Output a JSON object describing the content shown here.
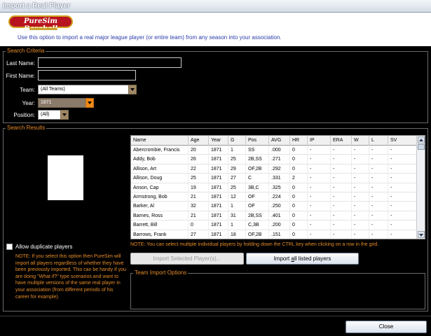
{
  "window": {
    "title": "Import a Real Player"
  },
  "banner": {
    "logo_text": "PureSim Baseball",
    "description": "Use this option to import a real major league player (or entire team) from any season into your association."
  },
  "search_criteria": {
    "label": "Search Criteria",
    "last_name_label": "Last Name:",
    "last_name_value": "",
    "first_name_label": "First Name:",
    "first_name_value": "",
    "team_label": "Team:",
    "team_value": "(All Teams)",
    "year_label": "Year:",
    "year_value": "1871",
    "position_label": "Position:",
    "position_value": "(All)"
  },
  "search_results": {
    "label": "Search Results",
    "allow_duplicates_label": "Allow duplicate players",
    "allow_duplicates_checked": false,
    "note": "NOTE: If you select this option then PureSim will import all players regardless of whether they have been previously imported.  This can be handy if you are doing \"What if?\" type scenarios and want to have multiple versions of the same real player in your association (from different periods of his career for example).",
    "grid_note": "NOTE: You can select multiple individual players by holding down the CTRL key when clicking on a row in the grid.",
    "columns": [
      "Name",
      "Age",
      "Year",
      "G",
      "Pos",
      "AVG",
      "HR",
      "IP",
      "ERA",
      "W",
      "L",
      "SV"
    ],
    "rows": [
      [
        "Abercrombie, Francis",
        "20",
        "1871",
        "1",
        "SS",
        ".000",
        "0",
        "-",
        "-",
        "-",
        "-",
        "-"
      ],
      [
        "Addy, Bob",
        "26",
        "1871",
        "25",
        "2B,SS",
        ".271",
        "0",
        "-",
        "-",
        "-",
        "-",
        "-"
      ],
      [
        "Allison, Art",
        "22",
        "1871",
        "29",
        "OF,2B",
        ".292",
        "0",
        "-",
        "-",
        "-",
        "-",
        "-"
      ],
      [
        "Allison, Doug",
        "25",
        "1871",
        "27",
        "C",
        ".331",
        "2",
        "-",
        "-",
        "-",
        "-",
        "-"
      ],
      [
        "Anson, Cap",
        "19",
        "1871",
        "25",
        "3B,C",
        ".325",
        "0",
        "-",
        "-",
        "-",
        "-",
        "-"
      ],
      [
        "Armstrong, Bob",
        "21",
        "1871",
        "12",
        "OF",
        ".224",
        "0",
        "-",
        "-",
        "-",
        "-",
        "-"
      ],
      [
        "Barker, Al",
        "32",
        "1871",
        "1",
        "OF",
        ".250",
        "0",
        "-",
        "-",
        "-",
        "-",
        "-"
      ],
      [
        "Barnes, Ross",
        "21",
        "1871",
        "31",
        "2B,SS",
        ".401",
        "0",
        "-",
        "-",
        "-",
        "-",
        "-"
      ],
      [
        "Barrett, Bill",
        "0",
        "1871",
        "1",
        "C,3B",
        ".200",
        "0",
        "-",
        "-",
        "-",
        "-",
        "-"
      ],
      [
        "Barrows, Frank",
        "27",
        "1871",
        "18",
        "OF,2B",
        ".151",
        "0",
        "-",
        "-",
        "-",
        "-",
        "-"
      ]
    ]
  },
  "buttons": {
    "import_selected": "Import Selected Player(s)...",
    "import_all_pre": "Import ",
    "import_all_u": "a",
    "import_all_post": "ll listed players",
    "close": "Close"
  },
  "team_import": {
    "label": "Team Import Options"
  }
}
